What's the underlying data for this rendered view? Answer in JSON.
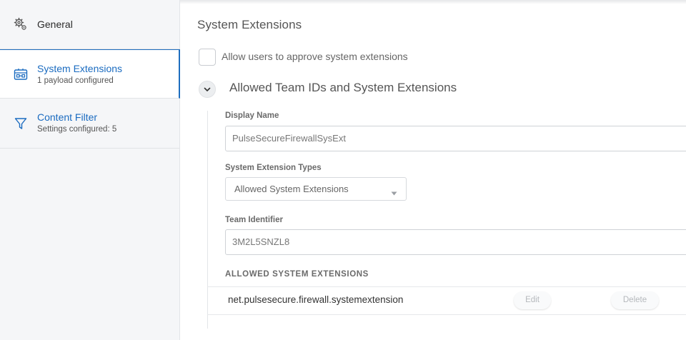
{
  "sidebar": {
    "items": [
      {
        "label": "General",
        "sub": ""
      },
      {
        "label": "System Extensions",
        "sub": "1 payload configured"
      },
      {
        "label": "Content Filter",
        "sub": "Settings configured: 5"
      }
    ]
  },
  "main": {
    "title": "System Extensions",
    "allow_checkbox_label": "Allow users to approve system extensions",
    "allow_checkbox_checked": false,
    "section_title": "Allowed Team IDs and System Extensions",
    "display_name_label": "Display Name",
    "display_name_value": "PulseSecureFirewallSysExt",
    "types_label": "System Extension Types",
    "types_value": "Allowed System Extensions",
    "team_id_label": "Team Identifier",
    "team_id_value": "3M2L5SNZL8",
    "allowed_header": "ALLOWED SYSTEM EXTENSIONS",
    "extensions": [
      {
        "name": "net.pulsesecure.firewall.systemextension",
        "edit_label": "Edit",
        "delete_label": "Delete"
      }
    ]
  },
  "colors": {
    "accent": "#1a6bc0",
    "sidebar_bg": "#f5f6f8"
  },
  "icons": {
    "general": "gear-icon",
    "system_extensions": "system-extension-icon",
    "content_filter": "filter-icon",
    "collapse": "chevron-down-icon",
    "select_caret": "caret-down-icon"
  }
}
